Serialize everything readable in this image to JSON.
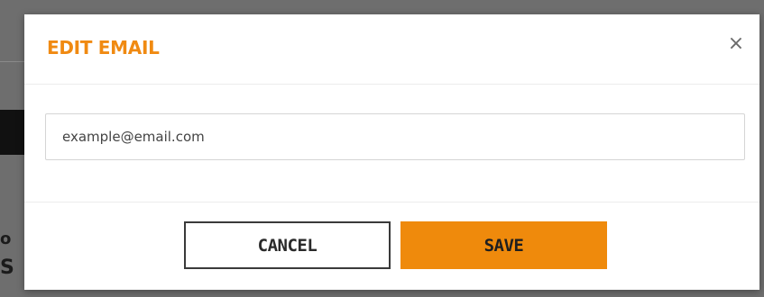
{
  "background": {
    "fragment_1": "o",
    "fragment_2": "S"
  },
  "modal": {
    "title": "EDIT EMAIL",
    "close_icon": "×",
    "email_value": "example@email.com",
    "cancel_label": "CANCEL",
    "save_label": "SAVE",
    "accent_color": "#ef8a0c"
  }
}
